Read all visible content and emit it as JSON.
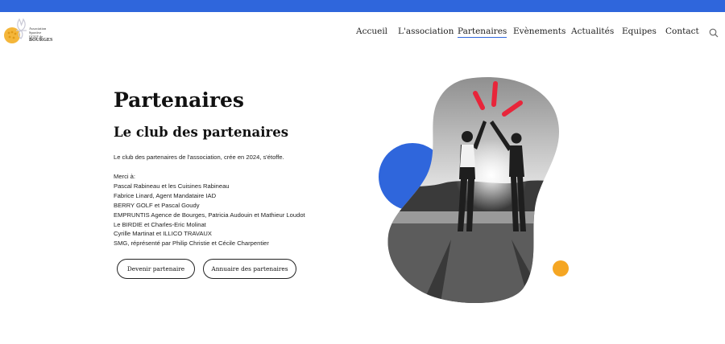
{
  "logo": {
    "line1": "Association",
    "line2": "Sportive",
    "line3": "GOLF de",
    "line4": "BOURGES"
  },
  "nav": {
    "items": [
      {
        "label": "Accueil"
      },
      {
        "label": "L'association"
      },
      {
        "label": "Partenaires",
        "active": true
      },
      {
        "label": "Evènements"
      },
      {
        "label": "Actualités"
      },
      {
        "label": "Equipes"
      },
      {
        "label": "Contact"
      }
    ]
  },
  "main": {
    "title": "Partenaires",
    "subtitle": "Le club des partenaires",
    "intro": "Le club des partenaires de l'association, crée en 2024, s'étoffe.",
    "thanks_heading": "Merci à:",
    "thanks": [
      "Pascal Rabineau et les Cuisines Rabineau",
      "Fabrice Linard, Agent Mandataire IAD",
      "BERRY GOLF et Pascal Goudy",
      "EMPRUNTIS Agence de Bourges, Patricia Audouin et Mathieur Loudot",
      "Le BIRDIE et Charles-Eric Molinat",
      "Cyrille Martinat et ILLICO TRAVAUX",
      "SMG, réprésenté par Philip Christie et Cécile Charpentier"
    ],
    "buttons": {
      "become_partner": "Devenir partenaire",
      "directory": "Annuaire des partenaires"
    }
  },
  "colors": {
    "accent_blue": "#2f66dc",
    "accent_orange": "#f5a623",
    "accent_red": "#e8253a"
  }
}
